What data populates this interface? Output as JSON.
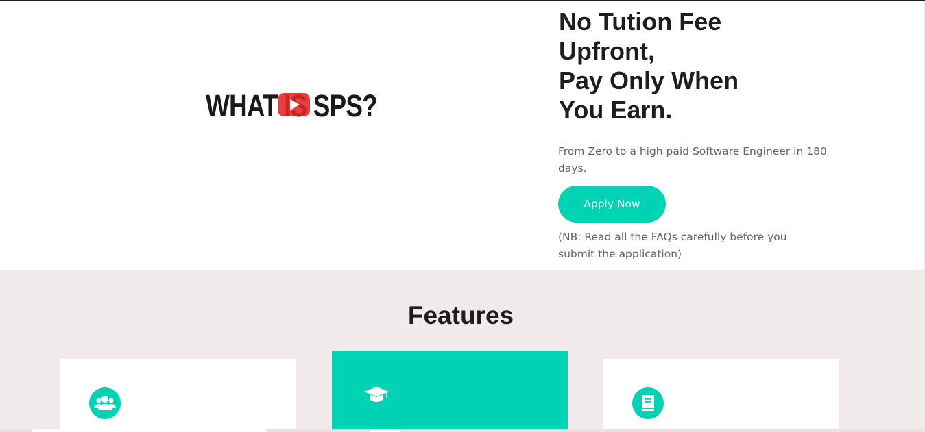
{
  "hero": {
    "video": {
      "title": "WHAT IS SPS?",
      "play_icon": "play-icon"
    },
    "headline_lines": [
      "No Tution Fee",
      "Upfront,",
      "Pay Only When",
      "You Earn."
    ],
    "description": "From Zero to a high paid Software Engineer in 180 days.",
    "apply_label": "Apply Now",
    "note": "(NB: Read all the FAQs carefully before you submit the application)"
  },
  "features": {
    "title": "Features",
    "cards": [
      {
        "icon": "users-icon",
        "active": false
      },
      {
        "icon": "graduation-cap-icon",
        "active": true
      },
      {
        "icon": "book-icon",
        "active": false
      }
    ]
  },
  "colors": {
    "accent": "#00d2b4",
    "features_bg": "#f0ebea",
    "heading": "#1b1d20",
    "body_text": "#5f6268"
  }
}
